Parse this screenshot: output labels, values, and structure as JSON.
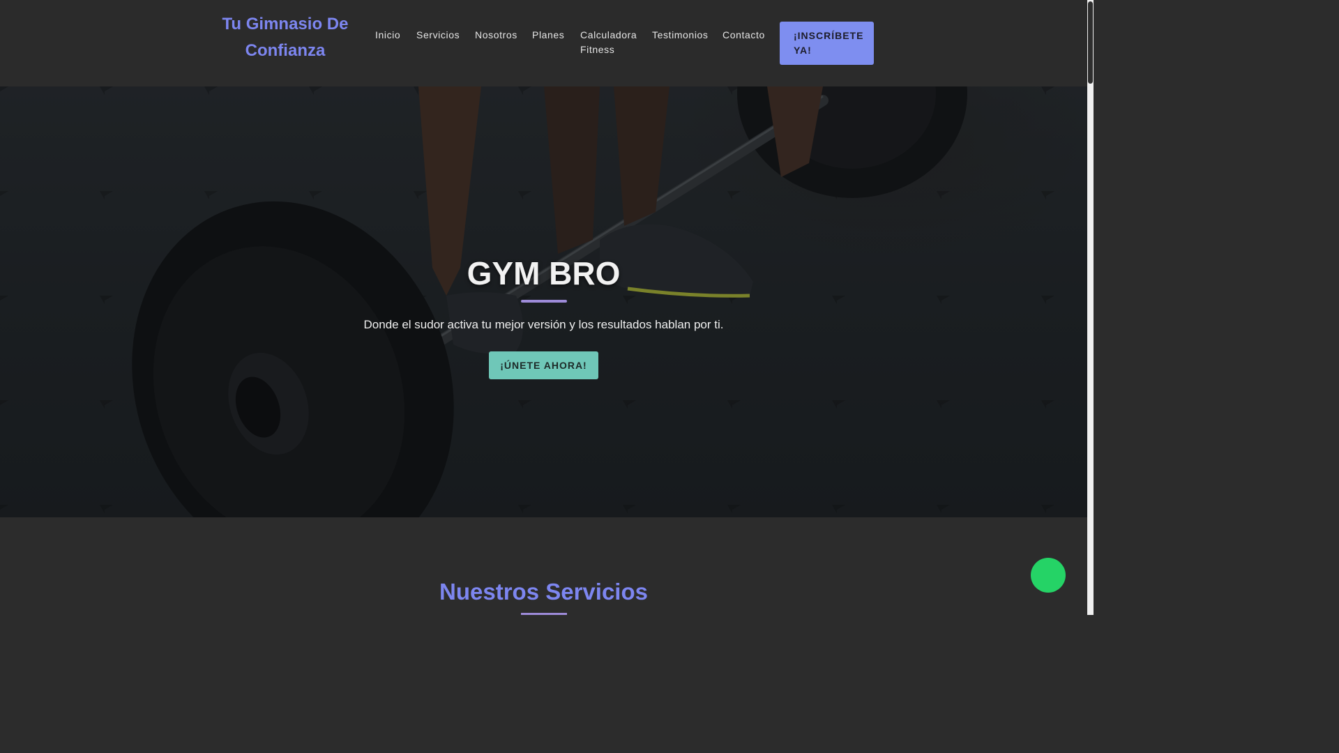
{
  "header": {
    "logo_line1": "Tu Gimnasio De",
    "logo_line2": "Confianza",
    "nav": {
      "inicio": "Inicio",
      "servicios": "Servicios",
      "nosotros": "Nosotros",
      "planes": "Planes",
      "calculadora_line1": "Calculadora",
      "calculadora_line2": "Fitness",
      "testimonios": "Testimonios",
      "contacto": "Contacto"
    },
    "cta_line1": "¡INSCRÍBETE",
    "cta_line2": "YA!"
  },
  "hero": {
    "title": "GYM BRO",
    "subtitle": "Donde el sudor activa tu mejor versión y los resultados hablan por ti.",
    "button_label": "¡ÚNETE AHORA!"
  },
  "services": {
    "title": "Nuestros Servicios"
  },
  "colors": {
    "accent": "#7d86f0",
    "hero_button": "#6fc7b8",
    "chat_button": "#25d366"
  },
  "icons": {
    "floating_button": "chat-bubble-icon"
  }
}
